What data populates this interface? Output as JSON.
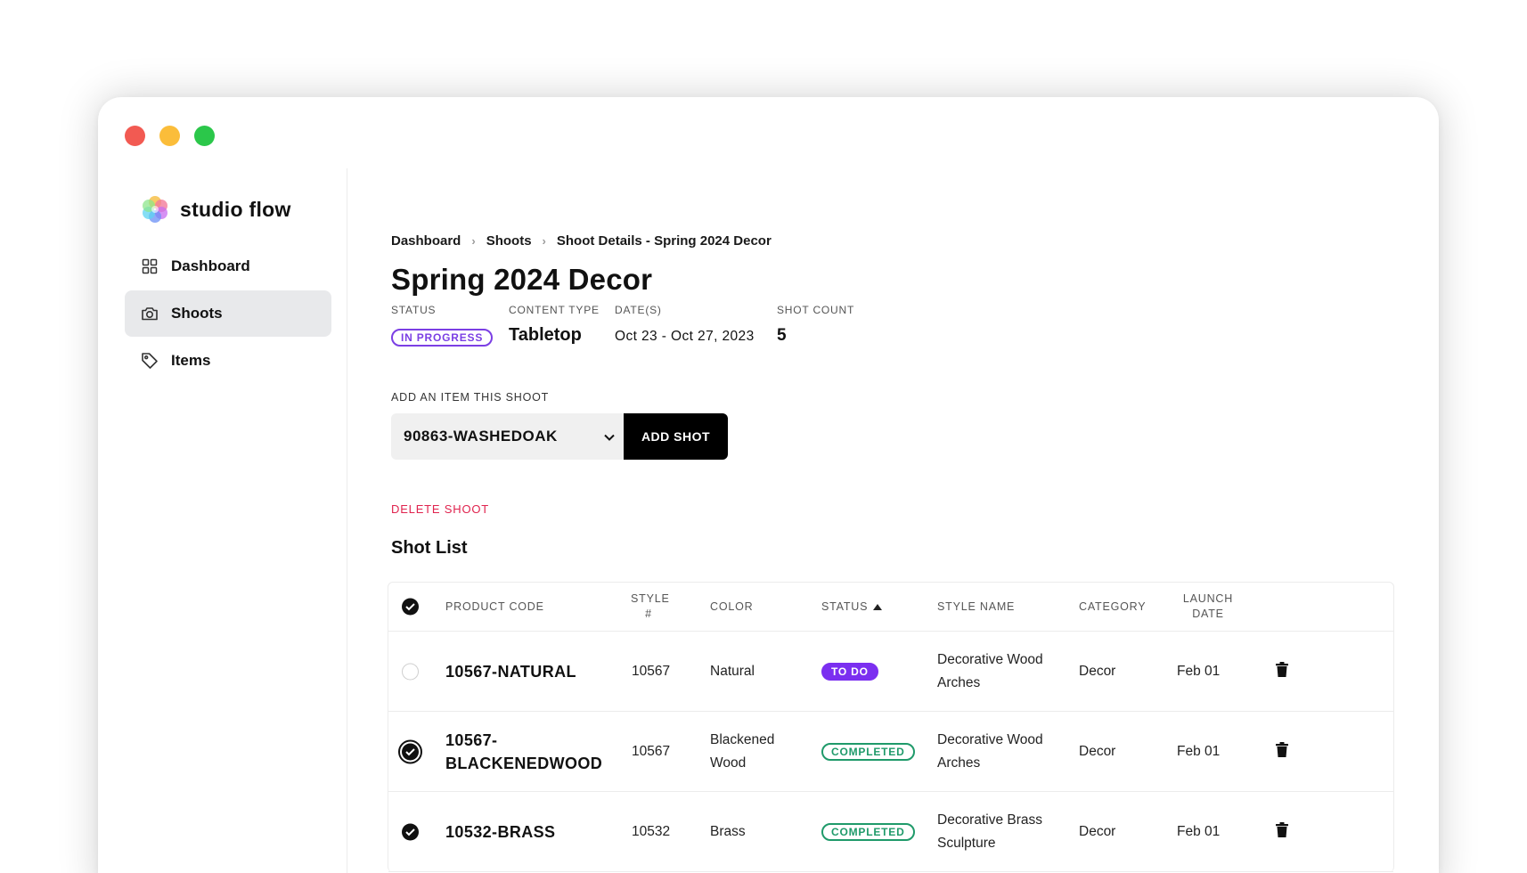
{
  "app": {
    "name": "studio flow"
  },
  "sidebar": {
    "items": [
      {
        "label": "Dashboard",
        "icon": "grid-icon",
        "active": false
      },
      {
        "label": "Shoots",
        "icon": "camera-icon",
        "active": true
      },
      {
        "label": "Items",
        "icon": "tag-icon",
        "active": false
      }
    ]
  },
  "breadcrumb": [
    "Dashboard",
    "Shoots",
    "Shoot Details - Spring 2024 Decor"
  ],
  "page": {
    "title": "Spring 2024 Decor"
  },
  "meta": {
    "status_label": "STATUS",
    "status_value": "IN PROGRESS",
    "content_type_label": "CONTENT TYPE",
    "content_type_value": "Tabletop",
    "dates_label": "DATE(S)",
    "dates_value": "Oct 23 - Oct 27, 2023",
    "shot_count_label": "SHOT COUNT",
    "shot_count_value": "5"
  },
  "add_item": {
    "label": "ADD AN ITEM THIS SHOOT",
    "selected": "90863-WASHEDOAK",
    "button": "ADD SHOT"
  },
  "delete_label": "DELETE SHOOT",
  "shot_list": {
    "title": "Shot List",
    "headers": {
      "product_code": "PRODUCT CODE",
      "style_line1": "STYLE",
      "style_line2": "#",
      "color": "COLOR",
      "status": "STATUS",
      "style_name": "STYLE NAME",
      "category": "CATEGORY",
      "launch_line1": "LAUNCH",
      "launch_line2": "DATE"
    },
    "rows": [
      {
        "code_line1": "10567-NATURAL",
        "code_line2": "",
        "style": "10567",
        "color_line1": "Natural",
        "color_line2": "",
        "status": "TO DO",
        "name_line1": "Decorative Wood",
        "name_line2": "Arches",
        "category": "Decor",
        "launch": "Feb 01"
      },
      {
        "code_line1": "10567-",
        "code_line2": "BLACKENEDWOOD",
        "style": "10567",
        "color_line1": "Blackened",
        "color_line2": "Wood",
        "status": "COMPLETED",
        "name_line1": "Decorative Wood",
        "name_line2": "Arches",
        "category": "Decor",
        "launch": "Feb 01"
      },
      {
        "code_line1": "10532-BRASS",
        "code_line2": "",
        "style": "10532",
        "color_line1": "Brass",
        "color_line2": "",
        "status": "COMPLETED",
        "name_line1": "Decorative Brass",
        "name_line2": "Sculpture",
        "category": "Decor",
        "launch": "Feb 01"
      }
    ]
  },
  "colors": {
    "accent_purple": "#7b3fe4",
    "completed_green": "#1f9a6a",
    "danger_red": "#e0234e"
  }
}
